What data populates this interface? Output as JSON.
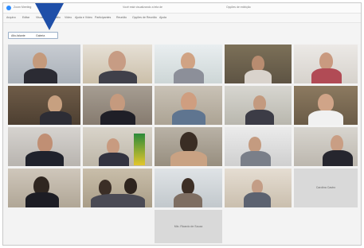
{
  "window": {
    "title": "Zoom Meeting",
    "center_text": "Você está visualizando a tela de",
    "right_text": "Opções de exibição"
  },
  "menubar": {
    "items": [
      "Arquivo",
      "Editar",
      "Visualizar",
      "Áudio",
      "Vídeo",
      "Ajuda e Vídeo",
      "Participantes",
      "Reunião",
      "Opções de Reunião",
      "Ajuda"
    ]
  },
  "toolbar": {
    "speaker_view_label": "Alto-falante",
    "gallery_view_label": "Galeria"
  },
  "participants": [
    {
      "name": ""
    },
    {
      "name": ""
    },
    {
      "name": ""
    },
    {
      "name": ""
    },
    {
      "name": ""
    },
    {
      "name": ""
    },
    {
      "name": ""
    },
    {
      "name": ""
    },
    {
      "name": ""
    },
    {
      "name": ""
    },
    {
      "name": ""
    },
    {
      "name": ""
    },
    {
      "name": ""
    },
    {
      "name": ""
    },
    {
      "name": ""
    },
    {
      "name": ""
    },
    {
      "name": ""
    },
    {
      "name": ""
    },
    {
      "name": ""
    },
    {
      "name": "Carolina Castro"
    },
    {
      "name": "Min. Ricardo de Souza"
    }
  ],
  "colors": {
    "marker": "#1f4fa8",
    "zoom_blue": "#2d8cff"
  }
}
